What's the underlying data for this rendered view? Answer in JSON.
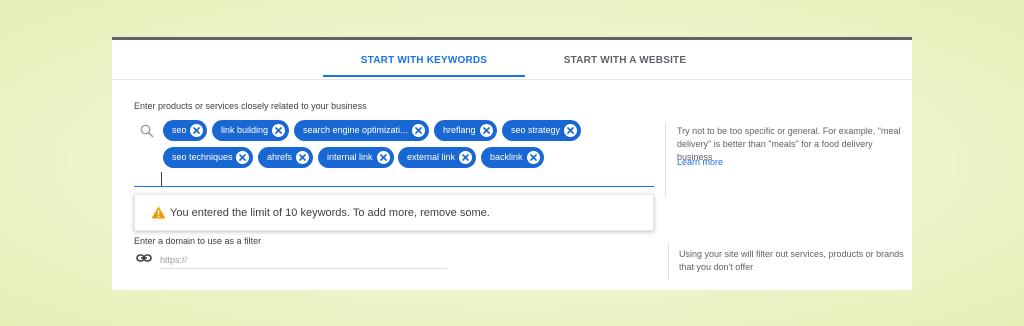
{
  "tabs": [
    {
      "label": "START WITH KEYWORDS",
      "active": true
    },
    {
      "label": "START WITH A WEBSITE",
      "active": false
    }
  ],
  "keywords_section": {
    "label": "Enter products or services closely related to your business",
    "icon": "search-icon",
    "chips": [
      "seo",
      "link building",
      "search engine optimizati...",
      "hreflang",
      "seo strategy",
      "seo techniques",
      "ahrefs",
      "internal link",
      "external link",
      "backlink"
    ],
    "help_text": "Try not to be too specific or general. For example, \"meal delivery\" is better than \"meals\" for a food delivery business",
    "learn_more": "Learn more"
  },
  "warning": {
    "icon": "warning-icon",
    "text": "You entered the limit of 10 keywords. To add more, remove some."
  },
  "domain_section": {
    "label": "Enter a domain to use as a filter",
    "icon": "link-icon",
    "placeholder": "https://",
    "value": "",
    "help_text": "Using your site will filter out services, products or brands that you don't offer"
  },
  "colors": {
    "accent": "#1a73e8",
    "chip": "#1967d2",
    "warning": "#f29900",
    "background": "#eef3c8"
  }
}
